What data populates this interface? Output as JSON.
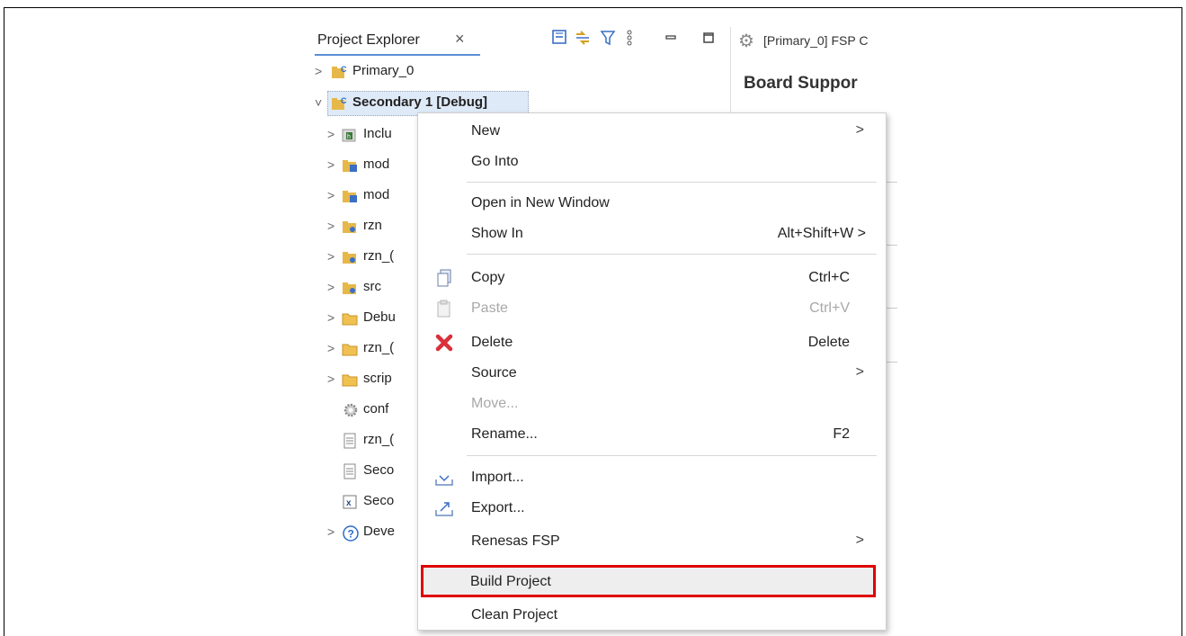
{
  "project_explorer": {
    "title": "Project Explorer",
    "close_glyph": "×",
    "toolbar_icons": [
      "collapse-all-icon",
      "link-with-editor-icon",
      "filter-icon",
      "view-menu-icon",
      "minimize-icon",
      "maximize-icon"
    ]
  },
  "editor": {
    "tab_label": "[Primary_0] FSP C",
    "heading": "Board Suppor"
  },
  "tree": {
    "items": [
      {
        "label": "Primary_0",
        "icon": "c-project-icon",
        "arrow": ">"
      },
      {
        "label": "Secondary 1 [Debug]",
        "icon": "c-project-icon",
        "arrow": "˅"
      },
      {
        "label": "Inclu",
        "icon": "includes-icon",
        "arrow": ">"
      },
      {
        "label": "mod",
        "icon": "module-folder-icon",
        "arrow": ">"
      },
      {
        "label": "mod",
        "icon": "module-folder-icon",
        "arrow": ">"
      },
      {
        "label": "rzn",
        "icon": "source-folder-icon",
        "arrow": ">"
      },
      {
        "label": "rzn_(",
        "icon": "source-folder-icon",
        "arrow": ">"
      },
      {
        "label": "src",
        "icon": "source-folder-icon",
        "arrow": ">"
      },
      {
        "label": "Debu",
        "icon": "folder-icon",
        "arrow": ">"
      },
      {
        "label": "rzn_(",
        "icon": "folder-icon",
        "arrow": ">"
      },
      {
        "label": "scrip",
        "icon": "folder-icon",
        "arrow": ">"
      },
      {
        "label": "conf",
        "icon": "config-gear-icon",
        "arrow": ""
      },
      {
        "label": "rzn_(",
        "icon": "file-icon",
        "arrow": ""
      },
      {
        "label": "Seco",
        "icon": "file-icon",
        "arrow": ""
      },
      {
        "label": "Seco",
        "icon": "xml-file-icon",
        "arrow": ""
      },
      {
        "label": "Deve",
        "icon": "help-icon",
        "arrow": ">"
      }
    ]
  },
  "context_menu": {
    "items": [
      {
        "label": "New",
        "shortcut": "",
        "submenu": true
      },
      {
        "label": "Go Into",
        "shortcut": "",
        "submenu": false
      },
      {
        "label": "Open in New Window",
        "shortcut": "",
        "submenu": false
      },
      {
        "label": "Show In",
        "shortcut": "Alt+Shift+W >",
        "submenu": false
      },
      {
        "label": "Copy",
        "shortcut": "Ctrl+C",
        "submenu": false,
        "icon": "copy-icon"
      },
      {
        "label": "Paste",
        "shortcut": "Ctrl+V",
        "submenu": false,
        "icon": "paste-icon",
        "disabled": true
      },
      {
        "label": "Delete",
        "shortcut": "Delete",
        "submenu": false,
        "icon": "delete-icon"
      },
      {
        "label": "Source",
        "shortcut": "",
        "submenu": true
      },
      {
        "label": "Move...",
        "shortcut": "",
        "submenu": false,
        "disabled": true
      },
      {
        "label": "Rename...",
        "shortcut": "F2",
        "submenu": false
      },
      {
        "label": "Import...",
        "shortcut": "",
        "submenu": false,
        "icon": "import-icon"
      },
      {
        "label": "Export...",
        "shortcut": "",
        "submenu": false,
        "icon": "export-icon"
      },
      {
        "label": "Renesas FSP",
        "shortcut": "",
        "submenu": true
      },
      {
        "label": "Build Project",
        "shortcut": "",
        "submenu": false,
        "highlighted": true
      },
      {
        "label": "Clean Project",
        "shortcut": "",
        "submenu": false
      }
    ]
  },
  "colors": {
    "highlight_border": "#e00000",
    "tab_underline": "#5b8fd6",
    "selection": "#dfeaf8"
  }
}
